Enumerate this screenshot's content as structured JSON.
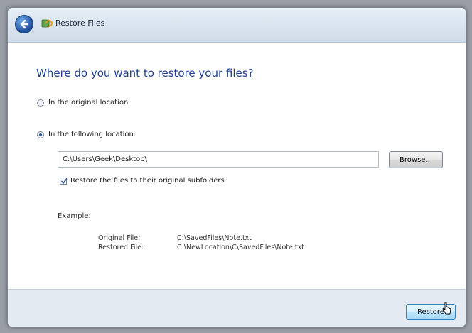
{
  "titlebar": {
    "title": "Restore Files"
  },
  "content": {
    "heading": "Where do you want to restore your files?",
    "options": {
      "original": {
        "label": "In the original location",
        "selected": false
      },
      "following": {
        "label": "In the following location:",
        "selected": true
      }
    },
    "path_value": "C:\\Users\\Geek\\Desktop\\",
    "browse_label": "Browse...",
    "subfolders": {
      "label": "Restore the files to their original subfolders",
      "checked": true
    },
    "example": {
      "label": "Example:",
      "original_key": "Original File:",
      "original_value": "C:\\SavedFiles\\Note.txt",
      "restored_key": "Restored File:",
      "restored_value": "C:\\NewLocation\\C\\SavedFiles\\Note.txt"
    }
  },
  "footer": {
    "restore_label": "Restore"
  }
}
